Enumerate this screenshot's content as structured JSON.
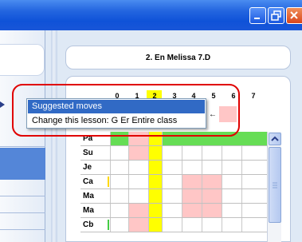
{
  "window": {
    "title": "",
    "controls": [
      "minimize",
      "restore",
      "close"
    ]
  },
  "header": {
    "class_title": "2. En Melissa 7.D"
  },
  "timetable": {
    "period_numbers": [
      "0",
      "1",
      "2",
      "3",
      "4",
      "5",
      "6",
      "7"
    ],
    "highlighted_period": "2",
    "days": [
      "Pa",
      "Su",
      "Je",
      "Ca",
      "Ma",
      "Ma",
      "Cb"
    ]
  },
  "context_menu": {
    "items": [
      {
        "label": "Suggested moves",
        "selected": true
      },
      {
        "label": "Change this lesson: G Er Entire class",
        "selected": false
      }
    ]
  },
  "colors": {
    "titlebar": "#0f52d8",
    "menu_highlight": "#316ac5",
    "period_highlight": "#ffff00",
    "lesson_green": "#66dd55",
    "blocked_pink": "#ffc6c6",
    "annotation_outline": "#e00000"
  }
}
